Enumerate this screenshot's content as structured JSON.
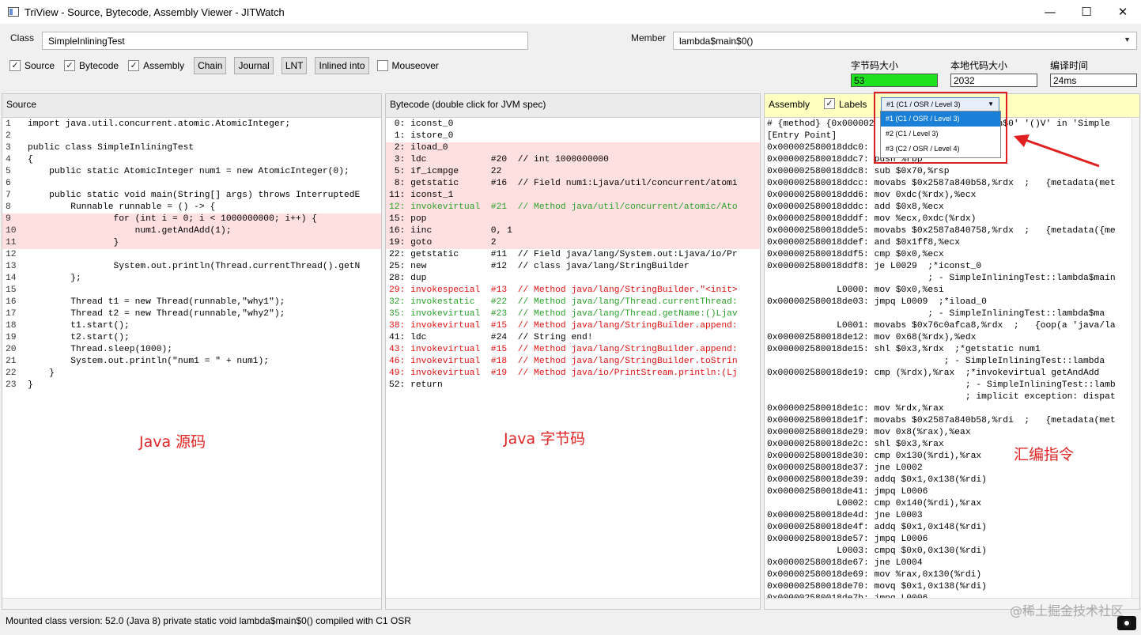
{
  "window": {
    "title": "TriView - Source, Bytecode, Assembly Viewer - JITWatch",
    "min": "—",
    "max": "☐",
    "close": "✕"
  },
  "toolbar": {
    "class_label": "Class",
    "class_value": "SimpleInliningTest",
    "member_label": "Member",
    "member_value": "lambda$main$0()",
    "checks": [
      {
        "label": "Source",
        "checked": true
      },
      {
        "label": "Bytecode",
        "checked": true
      },
      {
        "label": "Assembly",
        "checked": true
      }
    ],
    "buttons": [
      "Chain",
      "Journal",
      "LNT",
      "Inlined into"
    ],
    "mouseover_label": "Mouseover",
    "stats": [
      {
        "label": "字节码大小",
        "value": "53"
      },
      {
        "label": "本地代码大小",
        "value": "2032"
      },
      {
        "label": "编译时间",
        "value": "24ms"
      }
    ]
  },
  "source_pane": {
    "title": "Source",
    "annotation": "Java 源码",
    "lines": [
      {
        "n": "1",
        "t": "import java.util.concurrent.atomic.AtomicInteger;"
      },
      {
        "n": "2",
        "t": ""
      },
      {
        "n": "3",
        "t": "public class SimpleInliningTest"
      },
      {
        "n": "4",
        "t": "{"
      },
      {
        "n": "5",
        "t": "    public static AtomicInteger num1 = new AtomicInteger(0);"
      },
      {
        "n": "6",
        "t": ""
      },
      {
        "n": "7",
        "t": "    public static void main(String[] args) throws InterruptedE"
      },
      {
        "n": "8",
        "t": "        Runnable runnable = () -> {"
      },
      {
        "n": "9",
        "t": "                for (int i = 0; i < 1000000000; i++) {"
      },
      {
        "n": "10",
        "t": "                    num1.getAndAdd(1);"
      },
      {
        "n": "11",
        "t": "                }"
      },
      {
        "n": "12",
        "t": ""
      },
      {
        "n": "13",
        "t": "                System.out.println(Thread.currentThread().getN"
      },
      {
        "n": "14",
        "t": "        };"
      },
      {
        "n": "15",
        "t": ""
      },
      {
        "n": "16",
        "t": "        Thread t1 = new Thread(runnable,\"why1\");"
      },
      {
        "n": "17",
        "t": "        Thread t2 = new Thread(runnable,\"why2\");"
      },
      {
        "n": "18",
        "t": "        t1.start();"
      },
      {
        "n": "19",
        "t": "        t2.start();"
      },
      {
        "n": "20",
        "t": "        Thread.sleep(1000);"
      },
      {
        "n": "21",
        "t": "        System.out.println(\"num1 = \" + num1);"
      },
      {
        "n": "22",
        "t": "    }"
      },
      {
        "n": "23",
        "t": "}"
      }
    ],
    "highlighted": [
      "9",
      "10",
      "11"
    ]
  },
  "bytecode_pane": {
    "title": "Bytecode (double click for JVM spec)",
    "annotation": "Java 字节码",
    "lines": [
      {
        "t": " 0: iconst_0",
        "style": ""
      },
      {
        "t": " 1: istore_0",
        "style": ""
      },
      {
        "t": " 2: iload_0",
        "style": "hl"
      },
      {
        "t": " 3: ldc            #20  // int 1000000000",
        "style": "hl"
      },
      {
        "t": " 5: if_icmpge      22",
        "style": "hl"
      },
      {
        "t": " 8: getstatic      #16  // Field num1:Ljava/util/concurrent/atomi",
        "style": "hl"
      },
      {
        "t": "11: iconst_1",
        "style": "hl"
      },
      {
        "t": "12: invokevirtual  #21  // Method java/util/concurrent/atomic/Ato",
        "style": "hl green"
      },
      {
        "t": "15: pop",
        "style": "hl"
      },
      {
        "t": "16: iinc           0, 1",
        "style": "hl"
      },
      {
        "t": "19: goto           2",
        "style": "hl"
      },
      {
        "t": "22: getstatic      #11  // Field java/lang/System.out:Ljava/io/Pr",
        "style": ""
      },
      {
        "t": "25: new            #12  // class java/lang/StringBuilder",
        "style": ""
      },
      {
        "t": "28: dup",
        "style": ""
      },
      {
        "t": "29: invokespecial  #13  // Method java/lang/StringBuilder.\"<init>",
        "style": "red"
      },
      {
        "t": "32: invokestatic   #22  // Method java/lang/Thread.currentThread:",
        "style": "green"
      },
      {
        "t": "35: invokevirtual  #23  // Method java/lang/Thread.getName:()Ljav",
        "style": "green"
      },
      {
        "t": "38: invokevirtual  #15  // Method java/lang/StringBuilder.append:",
        "style": "red"
      },
      {
        "t": "41: ldc            #24  // String end!",
        "style": ""
      },
      {
        "t": "43: invokevirtual  #15  // Method java/lang/StringBuilder.append:",
        "style": "red"
      },
      {
        "t": "46: invokevirtual  #18  // Method java/lang/StringBuilder.toStrin",
        "style": "red"
      },
      {
        "t": "49: invokevirtual  #19  // Method java/io/PrintStream.println:(Lj",
        "style": "red"
      },
      {
        "t": "52: return",
        "style": ""
      }
    ]
  },
  "assembly_pane": {
    "title": "Assembly",
    "labels_label": "Labels",
    "level_value": "#1  (C1 / OSR / Level 3)",
    "level_options": [
      "#1  (C1 / OSR / Level 3)",
      "#2  (C1 / Level 3)",
      "#3  (C2 / OSR / Level 4)"
    ],
    "annotation": "汇编指令",
    "lines": [
      "# {method} {0x000002                    main$0' '()V' in 'Simple",
      "[Entry Point]",
      "0x000002580018ddc0:",
      "0x000002580018ddc7: push %rbp",
      "0x000002580018ddc8: sub $0x70,%rsp",
      "0x000002580018ddcc: movabs $0x2587a840b58,%rdx  ;   {metadata(met",
      "0x000002580018ddd6: mov 0xdc(%rdx),%ecx",
      "0x000002580018dddc: add $0x8,%ecx",
      "0x000002580018dddf: mov %ecx,0xdc(%rdx)",
      "0x000002580018dde5: movabs $0x2587a840758,%rdx  ;   {metadata({me",
      "0x000002580018ddef: and $0x1ff8,%ecx",
      "0x000002580018ddf5: cmp $0x0,%ecx",
      "0x000002580018ddf8: je L0029  ;*iconst_0",
      "                              ; - SimpleInliningTest::lambda$main",
      "             L0000: mov $0x0,%esi",
      "0x000002580018de03: jmpq L0009  ;*iload_0",
      "                              ; - SimpleInliningTest::lambda$ma",
      "             L0001: movabs $0x76c0afca8,%rdx  ;   {oop(a 'java/la",
      "0x000002580018de12: mov 0x68(%rdx),%edx",
      "0x000002580018de15: shl $0x3,%rdx  ;*getstatic num1",
      "                                 ; - SimpleInliningTest::lambda",
      "0x000002580018de19: cmp (%rdx),%rax  ;*invokevirtual getAndAdd",
      "                                     ; - SimpleInliningTest::lamb",
      "                                     ; implicit exception: dispat",
      "0x000002580018de1c: mov %rdx,%rax",
      "0x000002580018de1f: movabs $0x2587a840b58,%rdi  ;   {metadata(met",
      "0x000002580018de29: mov 0x8(%rax),%eax",
      "0x000002580018de2c: shl $0x3,%rax",
      "0x000002580018de30: cmp 0x130(%rdi),%rax",
      "0x000002580018de37: jne L0002",
      "0x000002580018de39: addq $0x1,0x138(%rdi)",
      "0x000002580018de41: jmpq L0006",
      "             L0002: cmp 0x140(%rdi),%rax",
      "0x000002580018de4d: jne L0003",
      "0x000002580018de4f: addq $0x1,0x148(%rdi)",
      "0x000002580018de57: jmpq L0006",
      "             L0003: cmpq $0x0,0x130(%rdi)",
      "0x000002580018de67: jne L0004",
      "0x000002580018de69: mov %rax,0x130(%rdi)",
      "0x000002580018de70: movq $0x1,0x138(%rdi)",
      "0x000002580018de7b: jmpq L0006"
    ]
  },
  "status": {
    "text": "Mounted class version: 52.0 (Java 8) private static void lambda$main$0() compiled with C1 OSR"
  },
  "watermark": "@稀土掘金技术社区",
  "colors": {
    "highlight_row": "#ffe0e0",
    "green_stat": "#1ee21e",
    "annotation_red": "#e02525",
    "assembly_header": "#ffffbf"
  }
}
